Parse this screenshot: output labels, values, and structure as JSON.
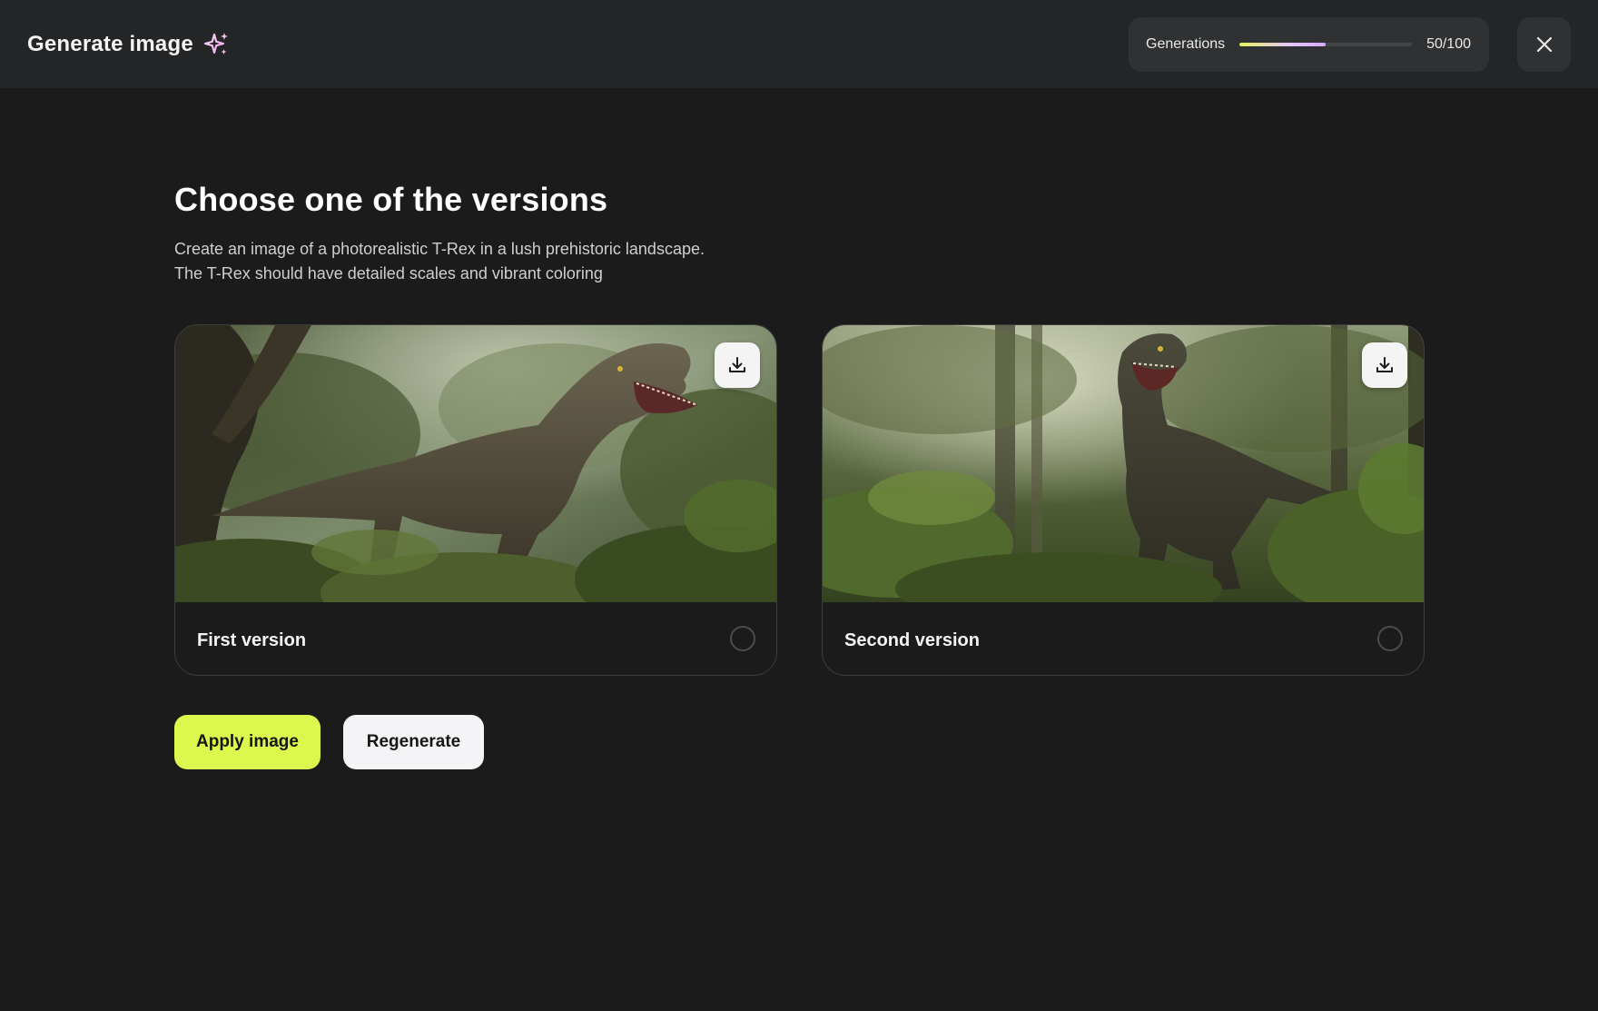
{
  "header": {
    "title": "Generate image",
    "title_icon": "sparkle-icon",
    "generations": {
      "label": "Generations",
      "used": 50,
      "total": 100,
      "count_text": "50/100"
    },
    "close_icon": "close-icon"
  },
  "main": {
    "title": "Choose one of the versions",
    "prompt_lines": [
      "Create an image of a photorealistic T-Rex in a lush prehistoric landscape.",
      "The T-Rex should have detailed scales and vibrant coloring"
    ],
    "versions": [
      {
        "label": "First version",
        "selected": false,
        "download_icon": "download-icon"
      },
      {
        "label": "Second version",
        "selected": false,
        "download_icon": "download-icon"
      }
    ]
  },
  "actions": {
    "apply_label": "Apply image",
    "regenerate_label": "Regenerate"
  },
  "colors": {
    "background": "#1b1b1b",
    "header": "#232526",
    "apply_accent": "#dcf84e",
    "progress_gradient_start": "#e6f25a",
    "progress_gradient_end": "#d8a7ff"
  }
}
